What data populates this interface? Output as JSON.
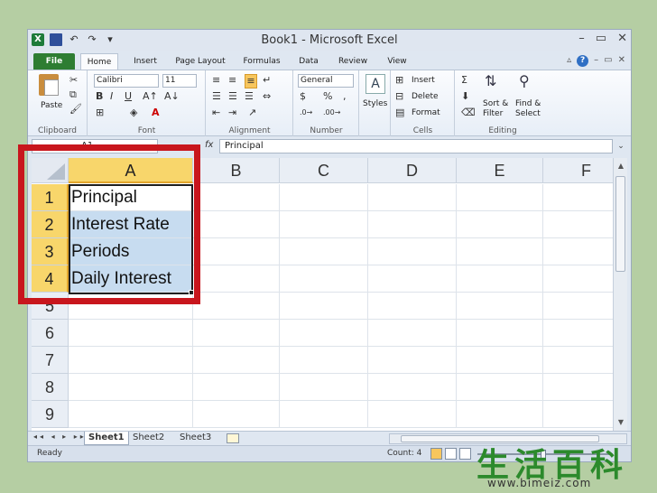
{
  "window": {
    "title": "Book1 - Microsoft Excel",
    "controls": [
      "–",
      "▭",
      "✕"
    ]
  },
  "ribbon_tabs": [
    "File",
    "Home",
    "Insert",
    "Page Layout",
    "Formulas",
    "Data",
    "Review",
    "View"
  ],
  "ribbon": {
    "clipboard": {
      "paste_label": "Paste",
      "group_label": "Clipboard"
    },
    "font": {
      "font_name": "Calibri",
      "font_size": "11",
      "bold": "B",
      "italic": "I",
      "underline": "U",
      "font_color": "A",
      "group_label": "Font"
    },
    "alignment": {
      "group_label": "Alignment"
    },
    "number": {
      "format": "General",
      "currency": "$",
      "percent": "%",
      "comma": ",",
      "group_label": "Number"
    },
    "styles": {
      "label": "Styles"
    },
    "cells": {
      "insert": "Insert",
      "delete": "Delete",
      "format": "Format",
      "group_label": "Cells"
    },
    "editing": {
      "autosum": "Σ",
      "sort_filter_1": "Sort &",
      "sort_filter_2": "Filter",
      "find_select_1": "Find &",
      "find_select_2": "Select",
      "group_label": "Editing"
    }
  },
  "formula_bar": {
    "name_box": "A1",
    "fx": "fx",
    "value": "Principal"
  },
  "grid": {
    "columns": [
      "A",
      "B",
      "C",
      "D",
      "E",
      "F"
    ],
    "rows": [
      "1",
      "2",
      "3",
      "4",
      "5",
      "6",
      "7",
      "8",
      "9"
    ],
    "cells_col_a": [
      "Principal",
      "Interest Rate",
      "Periods",
      "Daily Interest"
    ]
  },
  "sheets": [
    "Sheet1",
    "Sheet2",
    "Sheet3"
  ],
  "status": {
    "ready": "Ready",
    "count": "Count: 4"
  },
  "watermark": {
    "logo": "生活百科",
    "url": "www.bimeiz.com"
  },
  "colors": {
    "selection_header": "#f8d66b",
    "selection_fill": "#c7dcf0",
    "highlight_box": "#c8161d",
    "file_tab": "#2e7d32"
  }
}
